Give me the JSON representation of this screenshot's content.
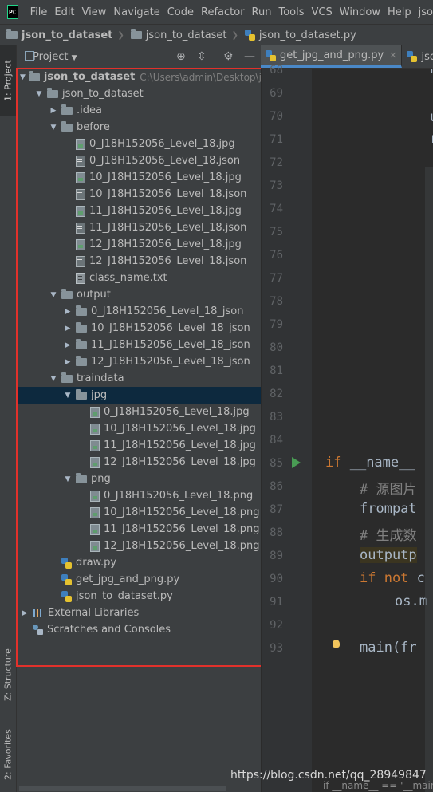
{
  "menu": [
    "File",
    "Edit",
    "View",
    "Navigate",
    "Code",
    "Refactor",
    "Run",
    "Tools",
    "VCS",
    "Window",
    "Help",
    "jso"
  ],
  "logo_text": "PC",
  "breadcrumbs": [
    "json_to_dataset",
    "json_to_dataset",
    "json_to_dataset.py"
  ],
  "left_strip": {
    "project": "1: Project",
    "structure": "Z: Structure",
    "favorites": "2: Favorites"
  },
  "panel": {
    "title": "Project"
  },
  "tree": [
    {
      "label": "json_to_dataset",
      "icon": "folder-icon",
      "arrow": "down",
      "indent": 0,
      "bold": true,
      "hint": "C:\\Users\\admin\\Desktop\\json"
    },
    {
      "label": "json_to_dataset",
      "icon": "folder-icon",
      "arrow": "down",
      "indent": 1
    },
    {
      "label": ".idea",
      "icon": "folder-icon",
      "arrow": "right",
      "indent": 2
    },
    {
      "label": "before",
      "icon": "folder-icon",
      "arrow": "down",
      "indent": 2
    },
    {
      "label": "0_J18H152056_Level_18.jpg",
      "icon": "jpg-file-icon",
      "indent": 3
    },
    {
      "label": "0_J18H152056_Level_18.json",
      "icon": "json-file-icon",
      "indent": 3
    },
    {
      "label": "10_J18H152056_Level_18.jpg",
      "icon": "jpg-file-icon",
      "indent": 3
    },
    {
      "label": "10_J18H152056_Level_18.json",
      "icon": "json-file-icon",
      "indent": 3
    },
    {
      "label": "11_J18H152056_Level_18.jpg",
      "icon": "jpg-file-icon",
      "indent": 3
    },
    {
      "label": "11_J18H152056_Level_18.json",
      "icon": "json-file-icon",
      "indent": 3
    },
    {
      "label": "12_J18H152056_Level_18.jpg",
      "icon": "jpg-file-icon",
      "indent": 3
    },
    {
      "label": "12_J18H152056_Level_18.json",
      "icon": "json-file-icon",
      "indent": 3
    },
    {
      "label": "class_name.txt",
      "icon": "text-file-icon",
      "indent": 3
    },
    {
      "label": "output",
      "icon": "folder-icon",
      "arrow": "down",
      "indent": 2
    },
    {
      "label": "0_J18H152056_Level_18_json",
      "icon": "folder-icon",
      "arrow": "right",
      "indent": 3
    },
    {
      "label": "10_J18H152056_Level_18_json",
      "icon": "folder-icon",
      "arrow": "right",
      "indent": 3
    },
    {
      "label": "11_J18H152056_Level_18_json",
      "icon": "folder-icon",
      "arrow": "right",
      "indent": 3
    },
    {
      "label": "12_J18H152056_Level_18_json",
      "icon": "folder-icon",
      "arrow": "right",
      "indent": 3
    },
    {
      "label": "traindata",
      "icon": "folder-icon",
      "arrow": "down",
      "indent": 2
    },
    {
      "label": "jpg",
      "icon": "folder-icon",
      "arrow": "down",
      "indent": 3,
      "selected": true
    },
    {
      "label": "0_J18H152056_Level_18.jpg",
      "icon": "jpg-file-icon",
      "indent": 4
    },
    {
      "label": "10_J18H152056_Level_18.jpg",
      "icon": "jpg-file-icon",
      "indent": 4
    },
    {
      "label": "11_J18H152056_Level_18.jpg",
      "icon": "jpg-file-icon",
      "indent": 4
    },
    {
      "label": "12_J18H152056_Level_18.jpg",
      "icon": "jpg-file-icon",
      "indent": 4
    },
    {
      "label": "png",
      "icon": "folder-icon",
      "arrow": "down",
      "indent": 3
    },
    {
      "label": "0_J18H152056_Level_18.png",
      "icon": "jpg-file-icon",
      "indent": 4
    },
    {
      "label": "10_J18H152056_Level_18.png",
      "icon": "jpg-file-icon",
      "indent": 4
    },
    {
      "label": "11_J18H152056_Level_18.png",
      "icon": "jpg-file-icon",
      "indent": 4
    },
    {
      "label": "12_J18H152056_Level_18.png",
      "icon": "jpg-file-icon",
      "indent": 4
    },
    {
      "label": "draw.py",
      "icon": "python-file-icon",
      "indent": 2
    },
    {
      "label": "get_jpg_and_png.py",
      "icon": "python-file-icon",
      "indent": 2
    },
    {
      "label": "json_to_dataset.py",
      "icon": "python-file-icon",
      "indent": 2
    },
    {
      "label": "External Libraries",
      "icon": "library-icon",
      "arrow": "right",
      "indent": 0
    },
    {
      "label": "Scratches and Consoles",
      "icon": "scratches-icon",
      "indent": 0
    }
  ],
  "tabs": [
    {
      "label": "get_jpg_and_png.py",
      "active": true
    },
    {
      "label": "json",
      "active": false
    }
  ],
  "line_numbers": [
    "68",
    "69",
    "70",
    "71",
    "72",
    "73",
    "74",
    "75",
    "76",
    "77",
    "78",
    "79",
    "80",
    "81",
    "82",
    "83",
    "84",
    "85",
    "86",
    "87",
    "88",
    "89",
    "90",
    "91",
    "92",
    "93"
  ],
  "code": {
    "l69": "h",
    "l70": "u",
    "l71": "r",
    "l85_kw": "if",
    "l85_rest": " __name__",
    "l86": "# 源图片",
    "l87": "frompat",
    "l88": "# 生成数",
    "l89": "outputp",
    "l90_kw": "if not",
    "l90_rest": " c",
    "l91": "os.m",
    "l93": "main(fr"
  },
  "status_hint": "if __name__ == '__main",
  "watermark": "https://blog.csdn.net/qq_28949847"
}
